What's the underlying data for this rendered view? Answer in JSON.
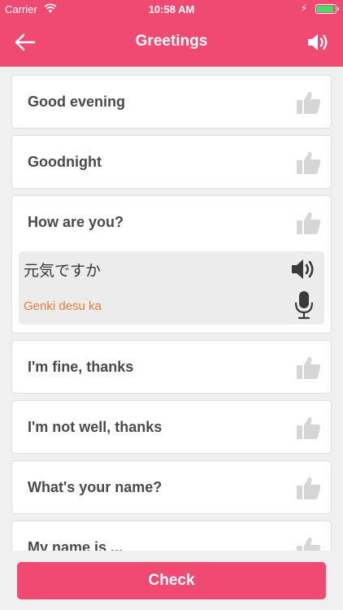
{
  "status_bar": {
    "carrier": "Carrier",
    "time": "10:58 AM",
    "battery_color": "#4cd964"
  },
  "nav": {
    "title": "Greetings",
    "back_icon": "back-arrow-icon",
    "sound_icon": "speaker-icon"
  },
  "phrases": [
    {
      "text": "Good evening"
    },
    {
      "text": "Goodnight"
    },
    {
      "text": "How are you?",
      "expanded": true,
      "japanese": "元気ですか",
      "romaji": "Genki desu ka"
    },
    {
      "text": "I'm fine, thanks"
    },
    {
      "text": "I'm not well, thanks"
    },
    {
      "text": "What's your name?"
    },
    {
      "text": "My name is ..."
    }
  ],
  "check_button": {
    "label": "Check"
  },
  "colors": {
    "accent": "#f14a72",
    "romaji": "#e87a3a",
    "thumb": "#d6d6d6"
  }
}
